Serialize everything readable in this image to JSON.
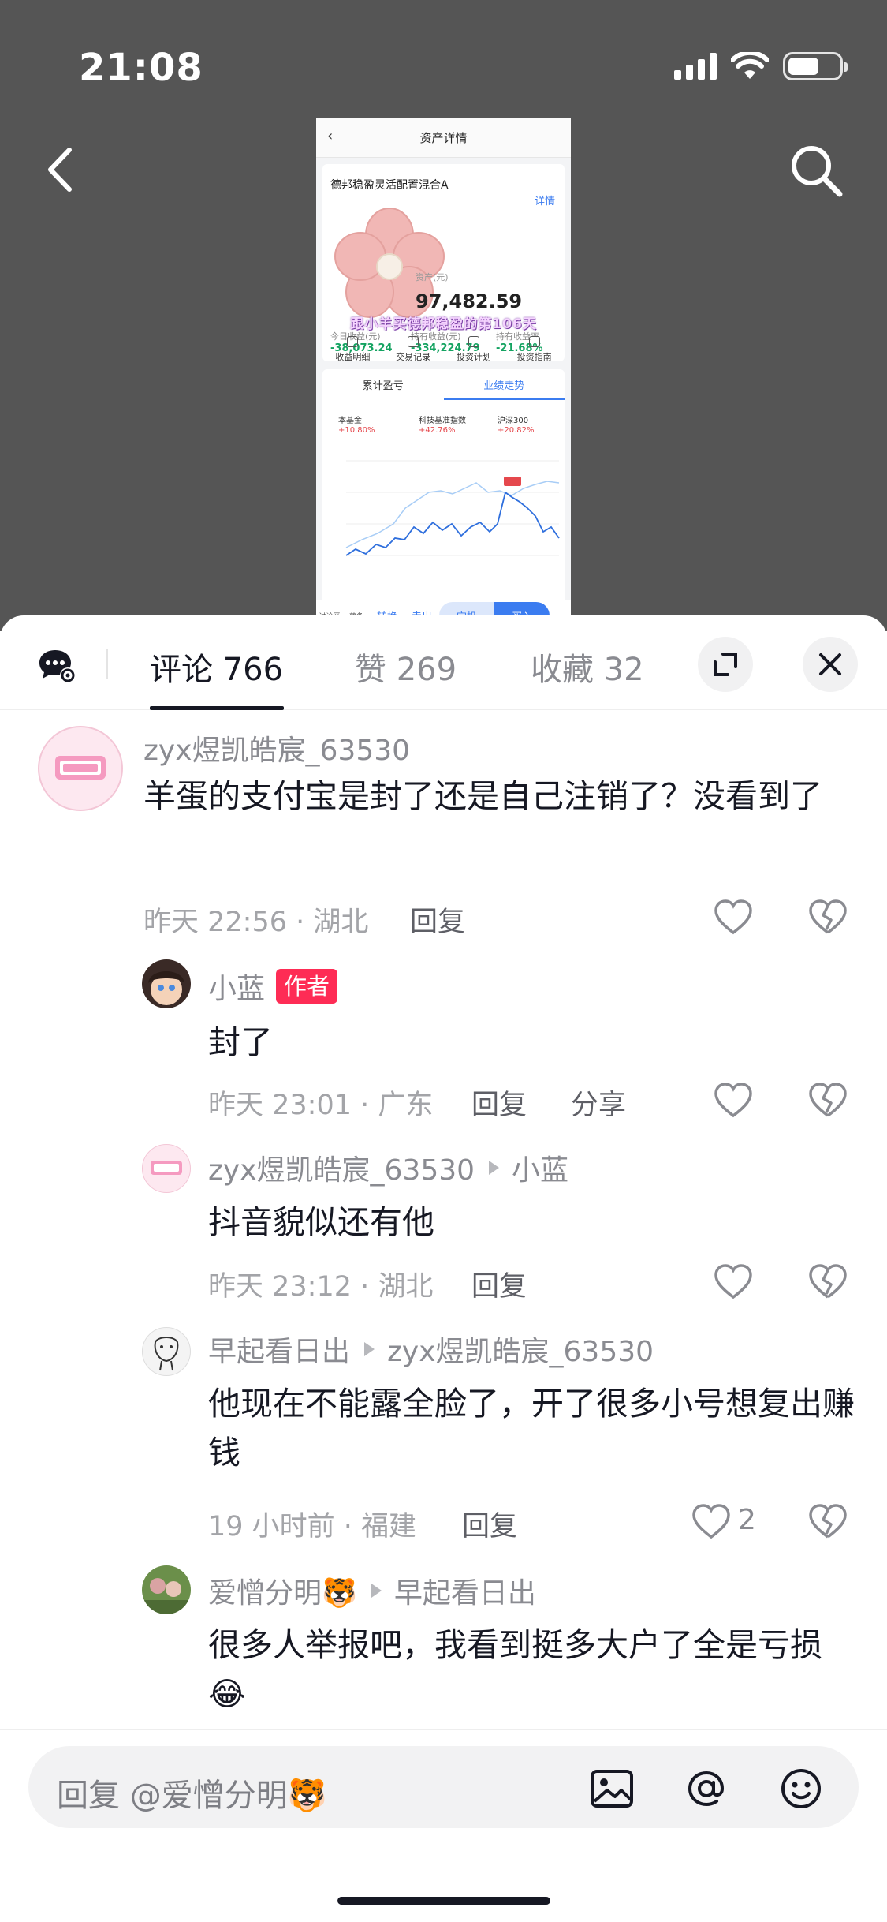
{
  "status_bar": {
    "time": "21:08",
    "battery_level": 0.62
  },
  "video": {
    "screenshot": {
      "title": "资产详情",
      "fund_name": "德邦稳盈灵活配置混合A",
      "detail_link": "详情",
      "asset_label": "资产(元)",
      "asset_value": "97,482.59",
      "stats": [
        {
          "label": "今日收益(元)",
          "value": "-38,073.24"
        },
        {
          "label": "持有收益(元)",
          "value": "-334,224.79"
        },
        {
          "label": "持有收益率",
          "value": "-21.68%"
        }
      ],
      "banner": "跟小羊买德邦稳盈的第106天",
      "menu": [
        "收益明细",
        "交易记录",
        "投资计划",
        "投资指南"
      ],
      "chart_tabs": [
        "累计盈亏",
        "业绩走势"
      ],
      "legend": [
        {
          "name": "本基金",
          "value": "+10.80%"
        },
        {
          "name": "科技基准指数",
          "value": "+42.76%"
        },
        {
          "name": "沪深300",
          "value": "+20.82%"
        }
      ],
      "bottom_bar": {
        "discuss": "讨论区",
        "tab2": "薯条",
        "switch": "转换",
        "sell": "卖出",
        "fixed": "定投",
        "buy": "买入"
      }
    }
  },
  "panel": {
    "tabs": [
      {
        "label": "评论 766"
      },
      {
        "label": "赞 269"
      },
      {
        "label": "收藏 32"
      }
    ],
    "comments": [
      {
        "user": "zyx煜凯皓宸_63530",
        "text": "羊蛋的支付宝是封了还是自己注销了？没看到了",
        "meta": "昨天 22:56 · 湖北",
        "reply": "回复"
      },
      {
        "user": "小蓝",
        "badge": "作者",
        "text": "封了",
        "meta": "昨天 23:01 · 广东",
        "reply": "回复",
        "share": "分享"
      },
      {
        "user": "zyx煜凯皓宸_63530",
        "reply_to": "小蓝",
        "text": "抖音貌似还有他",
        "meta": "昨天 23:12 · 湖北",
        "reply": "回复"
      },
      {
        "user": "早起看日出",
        "reply_to": "zyx煜凯皓宸_63530",
        "text": "他现在不能露全脸了，开了很多小号想复出赚钱",
        "meta": "19 小时前 · 福建",
        "reply": "回复",
        "likes": "2"
      },
      {
        "user": "爱憎分明🐯",
        "reply_to": "早起看日出",
        "text": "很多人举报吧，我看到挺多大户了全是亏损😂"
      }
    ],
    "input_placeholder": "回复 @爱憎分明🐯"
  }
}
